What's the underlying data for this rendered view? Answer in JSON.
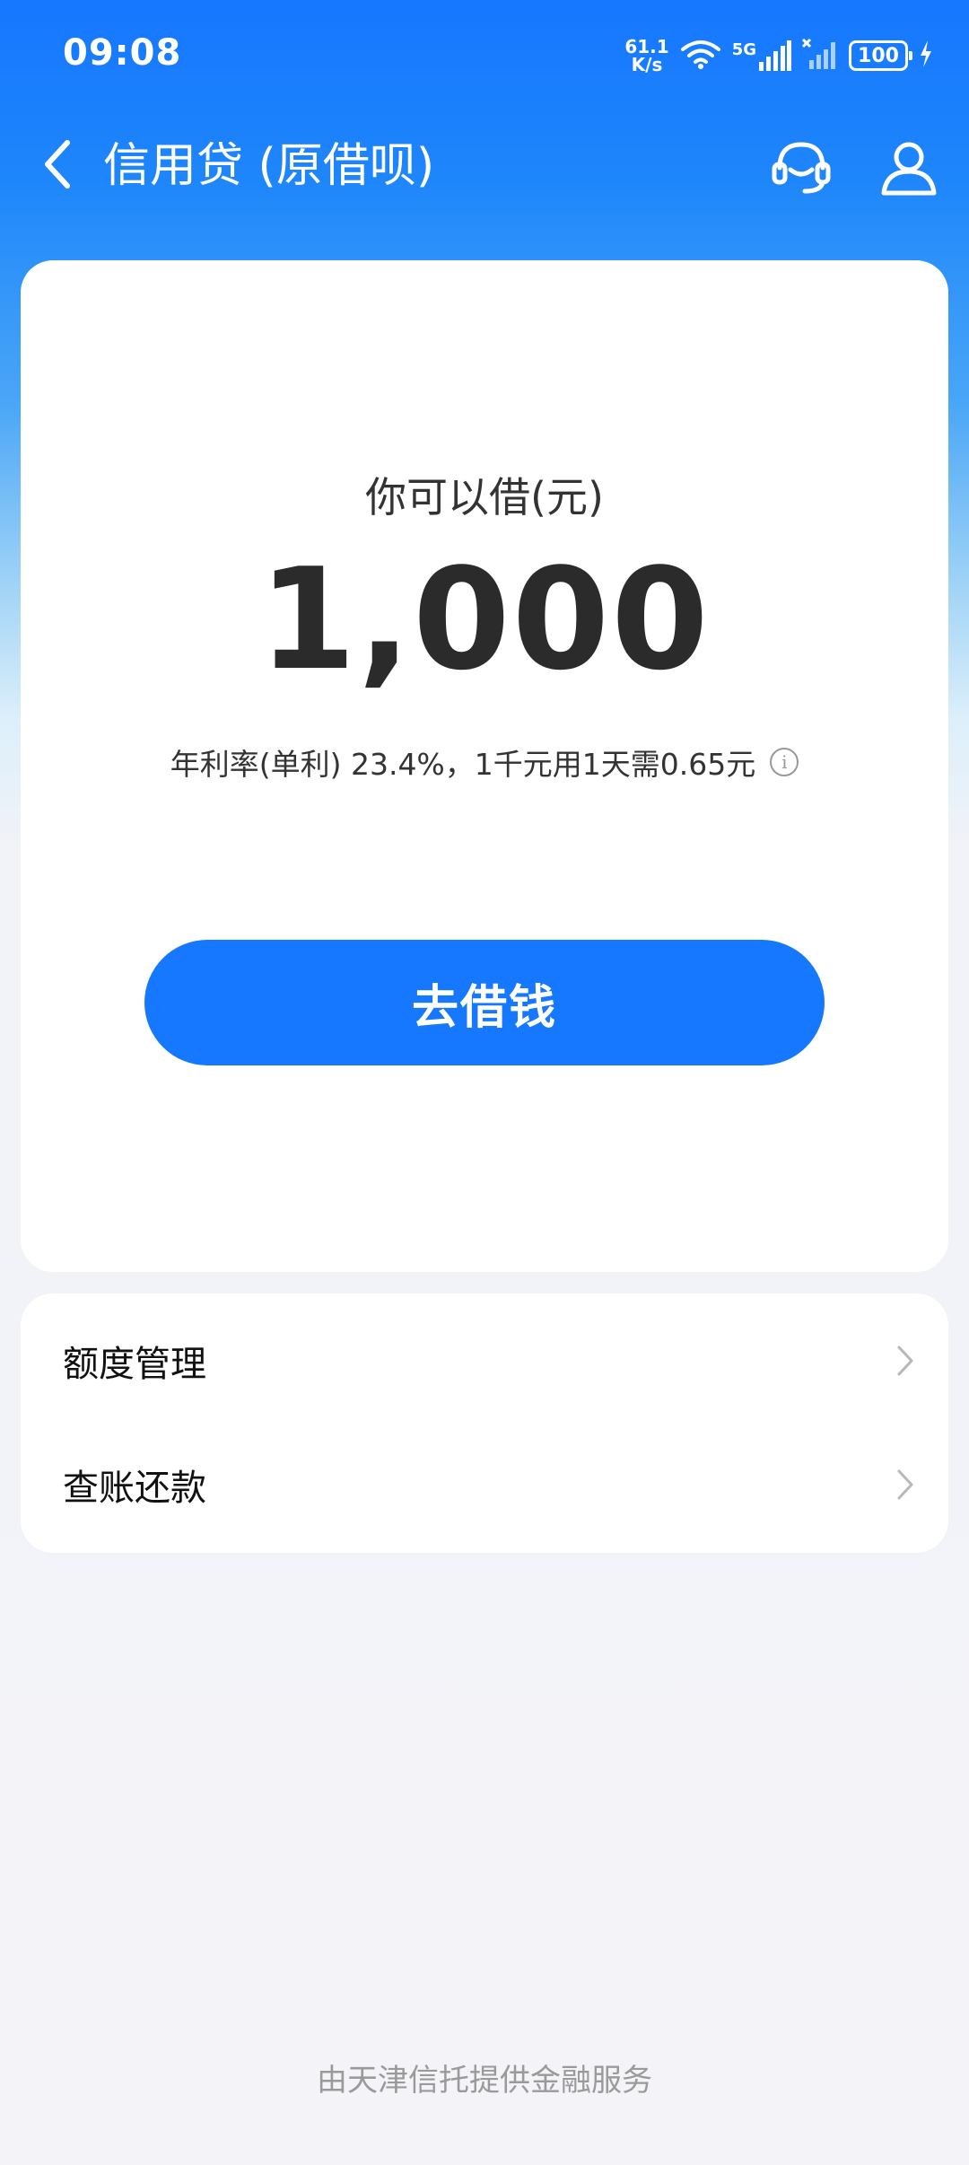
{
  "status_bar": {
    "time": "09:08",
    "net_speed_value": "61.1",
    "net_speed_unit": "K/s",
    "network_type": "5G",
    "battery": "100"
  },
  "header": {
    "title": "信用贷 (原借呗)",
    "icons": [
      "back-arrow-icon",
      "customer-service-icon",
      "user-profile-icon"
    ]
  },
  "loan_card": {
    "label": "你可以借(元)",
    "amount": "1,000",
    "rate_text": "年利率(单利) 23.4%，1千元用1天需0.65元",
    "borrow_button": "去借钱"
  },
  "menu": {
    "items": [
      {
        "label": "额度管理"
      },
      {
        "label": "查账还款"
      }
    ]
  },
  "footer": {
    "text": "由天津信托提供金融服务"
  },
  "colors": {
    "primary": "#1677ff",
    "background": "#f3f3f8",
    "card": "#ffffff"
  }
}
